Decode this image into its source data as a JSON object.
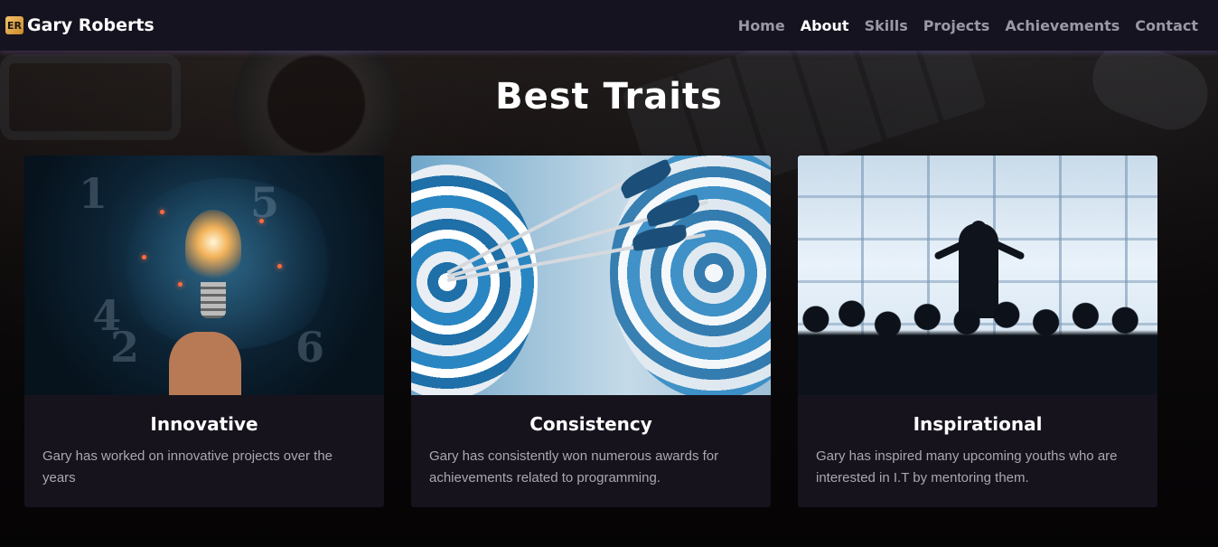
{
  "navbar": {
    "logo_text": "ER",
    "brand_name": "Gary Roberts",
    "links": [
      {
        "label": "Home",
        "active": false
      },
      {
        "label": "About",
        "active": true
      },
      {
        "label": "Skills",
        "active": false
      },
      {
        "label": "Projects",
        "active": false
      },
      {
        "label": "Achievements",
        "active": false
      },
      {
        "label": "Contact",
        "active": false
      }
    ]
  },
  "section": {
    "title": "Best Traits",
    "cards": [
      {
        "image": "lightbulb-brain-illustration",
        "title": "Innovative",
        "text": "Gary has worked on innovative projects over the years"
      },
      {
        "image": "archery-targets-arrows",
        "title": "Consistency",
        "text": "Gary has consistently won numerous awards for achievements related to programming."
      },
      {
        "image": "speaker-audience-silhouette",
        "title": "Inspirational",
        "text": "Gary has inspired many upcoming youths who are interested in I.T by mentoring them."
      }
    ]
  },
  "colors": {
    "navbar_bg": "#15131f",
    "card_bg": "#16131d",
    "nav_inactive": "#9a98a6",
    "nav_active": "#ffffff",
    "card_text": "#a9a7b2"
  }
}
